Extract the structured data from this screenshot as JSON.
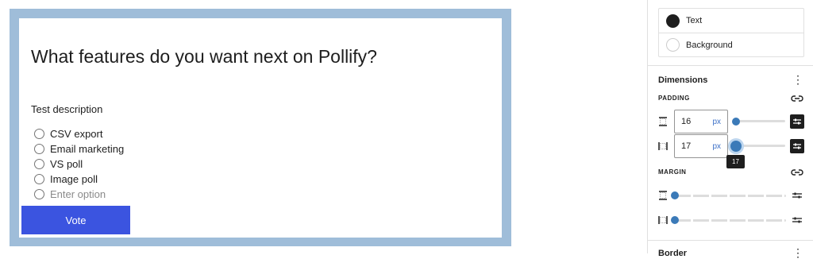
{
  "poll": {
    "title": "What features do you want next on Pollify?",
    "description": "Test description",
    "options": [
      "CSV export",
      "Email marketing",
      "VS poll",
      "Image poll"
    ],
    "new_option_placeholder": "Enter option",
    "vote_label": "Vote",
    "colors": {
      "frame": "#9fbdd9",
      "button": "#3b54e0"
    }
  },
  "sidebar": {
    "color_panel": {
      "items": [
        {
          "label": "Text",
          "swatch": "#1e1e1e"
        },
        {
          "label": "Background",
          "swatch": "#ffffff"
        }
      ]
    },
    "dimensions": {
      "title": "Dimensions",
      "padding": {
        "label": "PADDING",
        "vertical": {
          "value": "16",
          "unit": "px"
        },
        "horizontal": {
          "value": "17",
          "unit": "px"
        },
        "tooltip": "17"
      },
      "margin": {
        "label": "MARGIN"
      }
    },
    "next_panel_title": "Border"
  }
}
